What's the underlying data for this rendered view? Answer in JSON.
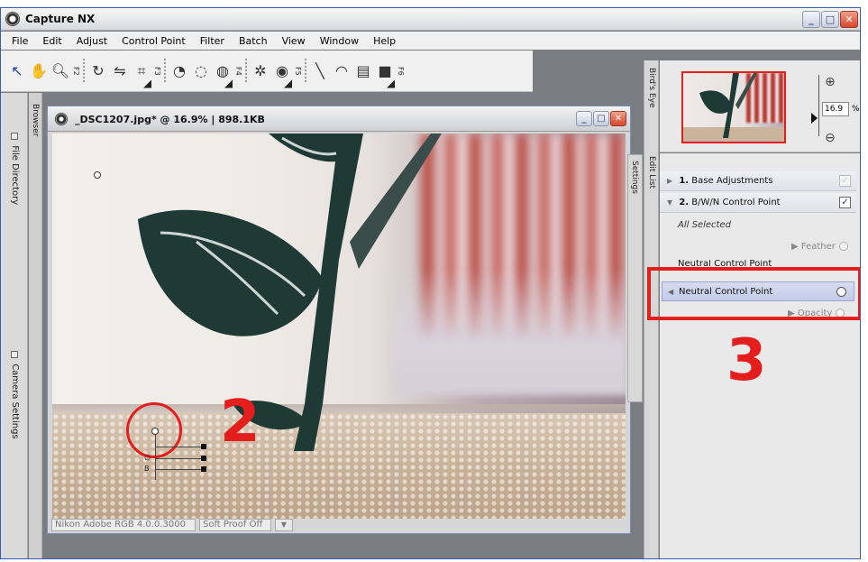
{
  "app": {
    "title": "Capture NX",
    "window_buttons": {
      "minimize": "_",
      "maximize": "□",
      "close": "✕"
    }
  },
  "menu": [
    "File",
    "Edit",
    "Adjust",
    "Control Point",
    "Filter",
    "Batch",
    "View",
    "Window",
    "Help"
  ],
  "toolbar": {
    "fn_labels": [
      "F2",
      "F3",
      "F4",
      "F5",
      "F6"
    ],
    "icons": [
      "direct-select-arrow-icon",
      "hand-icon",
      "zoom-icon",
      "rotate-icon",
      "straighten-icon",
      "crop-icon",
      "black-point-icon",
      "white-point-icon",
      "neutral-point-icon",
      "red-eye-icon",
      "color-point-icon",
      "line-icon",
      "lasso-icon",
      "gradient-icon",
      "fill-icon"
    ]
  },
  "left_panels": {
    "browser": "Browser",
    "file_directory": "File Directory",
    "camera_settings": "Camera Settings"
  },
  "image_window": {
    "title": "_DSC1207.jpg* @ 16.9% | 898.1KB",
    "status": {
      "profile": "Nikon Adobe RGB 4.0.0.3000",
      "soft_proof": "Soft Proof Off"
    }
  },
  "annotations": {
    "two": "2",
    "three": "3"
  },
  "control_point_tags": [
    "∅",
    "B"
  ],
  "right_panels": {
    "birds_eye": "Bird's Eye",
    "edit_list": "Edit List",
    "settings": "Settings",
    "zoom_value": "16.9",
    "zoom_unit": "%"
  },
  "edit_list": {
    "step1_num": "1.",
    "step1_label": "Base Adjustments",
    "step2_num": "2.",
    "step2_label": "B/W/N Control Point",
    "all_selected": "All Selected",
    "feather": "Feather",
    "ncp_partial": "Neutral Control Point",
    "ncp_selected": "Neutral Control Point",
    "opacity": "Opacity"
  },
  "colors": {
    "annotation_red": "#e41d1d",
    "selection_blue": "#c4cbe8"
  }
}
